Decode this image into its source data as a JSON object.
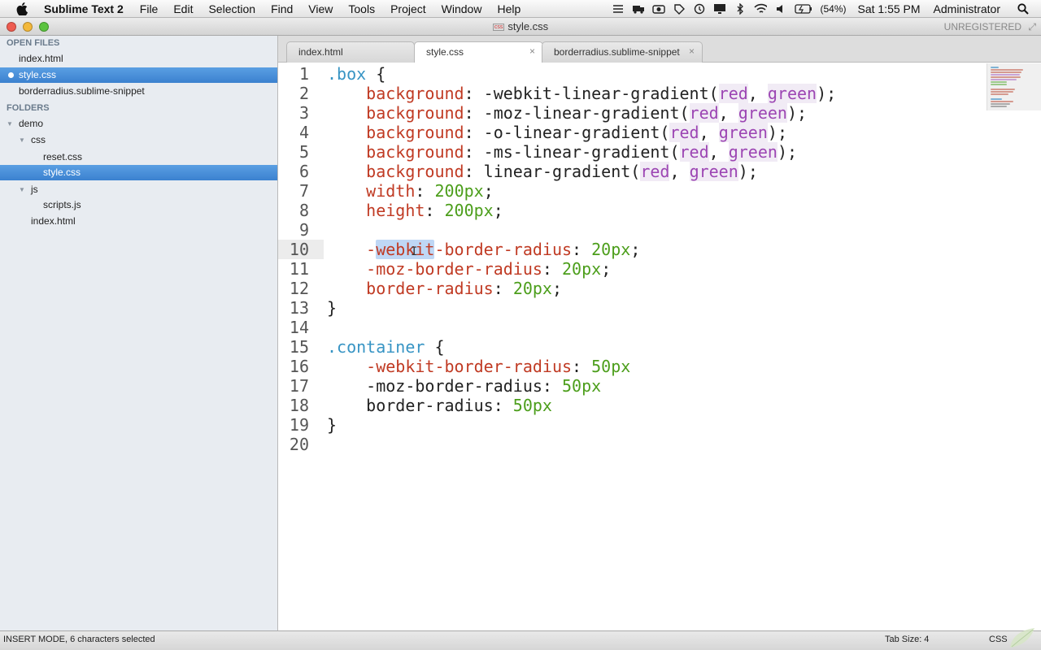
{
  "menubar": {
    "app_name": "Sublime Text 2",
    "menus": [
      "File",
      "Edit",
      "Selection",
      "Find",
      "View",
      "Tools",
      "Project",
      "Window",
      "Help"
    ],
    "battery": "(54%)",
    "clock": "Sat 1:55 PM",
    "user": "Administrator"
  },
  "window": {
    "title": "style.css",
    "file_badge": "css",
    "registration": "UNREGISTERED"
  },
  "sidebar": {
    "open_files_header": "OPEN FILES",
    "open_files": [
      {
        "label": "index.html",
        "selected": false
      },
      {
        "label": "style.css",
        "selected": true
      },
      {
        "label": "borderradius.sublime-snippet",
        "selected": false
      }
    ],
    "folders_header": "FOLDERS",
    "tree": [
      {
        "label": "demo",
        "type": "folder",
        "depth": 0
      },
      {
        "label": "css",
        "type": "folder",
        "depth": 1
      },
      {
        "label": "reset.css",
        "type": "file",
        "depth": 2
      },
      {
        "label": "style.css",
        "type": "file",
        "depth": 2,
        "selected": true
      },
      {
        "label": "js",
        "type": "folder",
        "depth": 1
      },
      {
        "label": "scripts.js",
        "type": "file",
        "depth": 2
      },
      {
        "label": "index.html",
        "type": "file",
        "depth": 1
      }
    ]
  },
  "tabs": [
    {
      "label": "index.html",
      "active": false
    },
    {
      "label": "style.css",
      "active": true
    },
    {
      "label": "borderradius.sublime-snippet",
      "active": false
    }
  ],
  "editor": {
    "current_line": 10,
    "lines": [
      [
        [
          "sel",
          ".box"
        ],
        [
          "punc",
          " {"
        ]
      ],
      [
        [
          "punc",
          "    "
        ],
        [
          "prop",
          "background"
        ],
        [
          "punc",
          ": -webkit-linear-gradient("
        ],
        [
          "arg",
          "red"
        ],
        [
          "punc",
          ", "
        ],
        [
          "arg",
          "green"
        ],
        [
          "punc",
          ");"
        ]
      ],
      [
        [
          "punc",
          "    "
        ],
        [
          "prop",
          "background"
        ],
        [
          "punc",
          ": -moz-linear-gradient("
        ],
        [
          "arg",
          "red"
        ],
        [
          "punc",
          ", "
        ],
        [
          "arg",
          "green"
        ],
        [
          "punc",
          ");"
        ]
      ],
      [
        [
          "punc",
          "    "
        ],
        [
          "prop",
          "background"
        ],
        [
          "punc",
          ": -o-linear-gradient("
        ],
        [
          "arg",
          "red"
        ],
        [
          "punc",
          ", "
        ],
        [
          "arg",
          "green"
        ],
        [
          "punc",
          ");"
        ]
      ],
      [
        [
          "punc",
          "    "
        ],
        [
          "prop",
          "background"
        ],
        [
          "punc",
          ": -ms-linear-gradient("
        ],
        [
          "arg",
          "red"
        ],
        [
          "punc",
          ", "
        ],
        [
          "arg",
          "green"
        ],
        [
          "punc",
          ");"
        ]
      ],
      [
        [
          "punc",
          "    "
        ],
        [
          "prop",
          "background"
        ],
        [
          "punc",
          ": linear-gradient("
        ],
        [
          "arg",
          "red"
        ],
        [
          "punc",
          ", "
        ],
        [
          "arg",
          "green"
        ],
        [
          "punc",
          ");"
        ]
      ],
      [
        [
          "punc",
          "    "
        ],
        [
          "prop",
          "width"
        ],
        [
          "punc",
          ": "
        ],
        [
          "num",
          "200px"
        ],
        [
          "punc",
          ";"
        ]
      ],
      [
        [
          "punc",
          "    "
        ],
        [
          "prop",
          "height"
        ],
        [
          "punc",
          ": "
        ],
        [
          "num",
          "200px"
        ],
        [
          "punc",
          ";"
        ]
      ],
      [
        [
          "punc",
          ""
        ]
      ],
      [
        [
          "punc",
          "    "
        ],
        [
          "prop",
          "-"
        ],
        [
          "selprop",
          "webkit"
        ],
        [
          "prop",
          "-border-radius"
        ],
        [
          "punc",
          ": "
        ],
        [
          "num",
          "20px"
        ],
        [
          "punc",
          ";"
        ]
      ],
      [
        [
          "punc",
          "    "
        ],
        [
          "prop",
          "-moz-border-radius"
        ],
        [
          "punc",
          ": "
        ],
        [
          "num",
          "20px"
        ],
        [
          "punc",
          ";"
        ]
      ],
      [
        [
          "punc",
          "    "
        ],
        [
          "prop",
          "border-radius"
        ],
        [
          "punc",
          ": "
        ],
        [
          "num",
          "20px"
        ],
        [
          "punc",
          ";"
        ]
      ],
      [
        [
          "punc",
          "}"
        ]
      ],
      [
        [
          "punc",
          ""
        ]
      ],
      [
        [
          "sel",
          ".container"
        ],
        [
          "punc",
          " {"
        ]
      ],
      [
        [
          "punc",
          "    "
        ],
        [
          "prop",
          "-webkit-border-radius"
        ],
        [
          "punc",
          ": "
        ],
        [
          "num",
          "50px"
        ]
      ],
      [
        [
          "punc",
          "    "
        ],
        [
          "plain",
          "-moz-border-radius: "
        ],
        [
          "num",
          "50px"
        ]
      ],
      [
        [
          "punc",
          "    "
        ],
        [
          "plain",
          "border-radius: "
        ],
        [
          "num",
          "50px"
        ]
      ],
      [
        [
          "punc",
          "}"
        ]
      ],
      [
        [
          "punc",
          ""
        ]
      ]
    ]
  },
  "statusbar": {
    "mode": "INSERT MODE, 6 characters selected",
    "tab_size": "Tab Size: 4",
    "syntax": "CSS"
  },
  "colors": {
    "selector": "#3794c4",
    "property": "#c03a23",
    "number": "#4c9e1b",
    "argument": "#9c45b3",
    "selection": "#4a90d9"
  }
}
